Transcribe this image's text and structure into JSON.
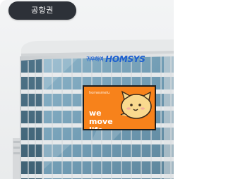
{
  "location_chip": {
    "label": "공항권"
  },
  "building": {
    "rooftop_sign": {
      "korean_text": "귀우하여",
      "brand_text": "HOMSYS"
    },
    "billboard": {
      "brand_text": "homesmelu",
      "slogan_line1": "we",
      "slogan_line2": "move life.",
      "accent_color": "#f7821b",
      "mascot_icon": "cartoon-cat-character"
    }
  },
  "colors": {
    "chip_background": "#2d3138",
    "sign_blue": "#1d5fd0",
    "billboard_orange": "#f7821b"
  }
}
